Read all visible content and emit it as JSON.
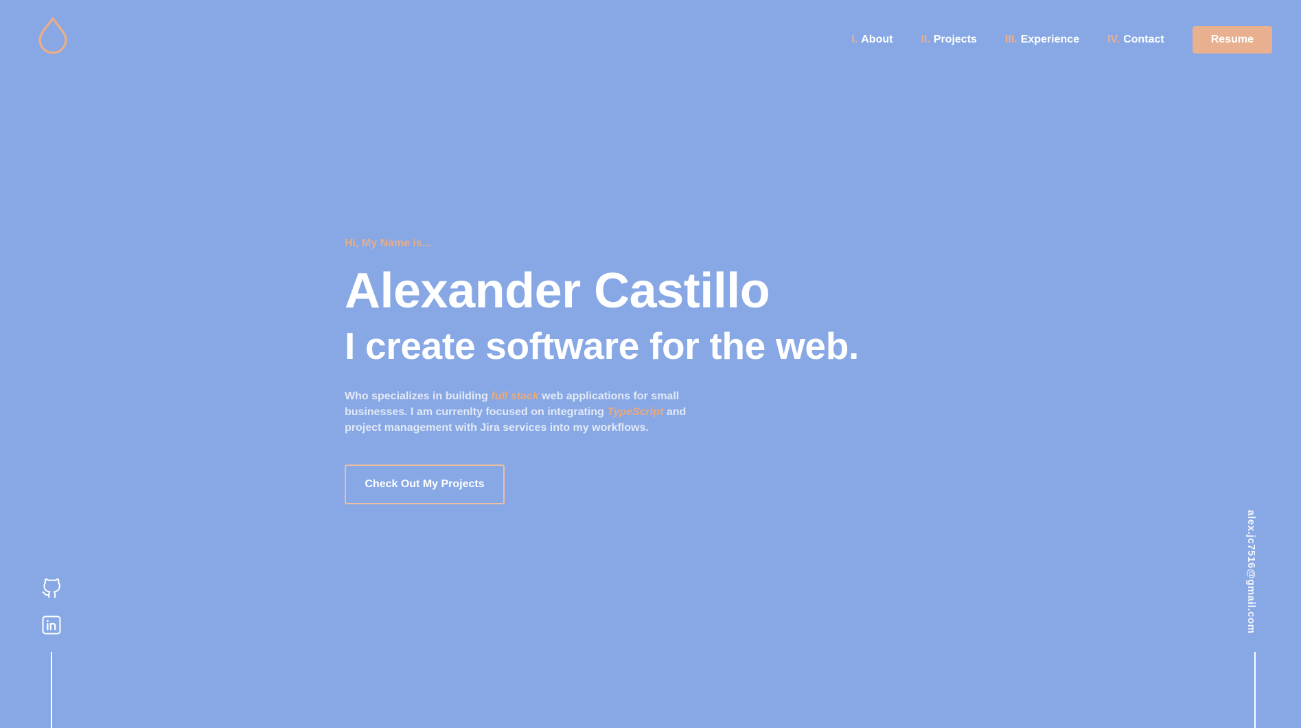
{
  "colors": {
    "background": "#87a8e5",
    "accent": "#e8b08f",
    "text": "#ffffff"
  },
  "header": {
    "logo_icon": "water-drop-icon",
    "nav": [
      {
        "number": "I.",
        "label": "About"
      },
      {
        "number": "II.",
        "label": "Projects"
      },
      {
        "number": "III.",
        "label": "Experience"
      },
      {
        "number": "IV.",
        "label": "Contact"
      }
    ],
    "resume_label": "Resume"
  },
  "hero": {
    "intro": "Hi, My Name is...",
    "name": "Alexander Castillo",
    "tagline": "I create software for the web.",
    "description": {
      "part1": "Who specializes in building ",
      "highlight1": "full stack",
      "part2": " web applications for small businesses. I am currenlty focused on integrating ",
      "highlight2": "TypeScript",
      "part3": " and project management with Jira services into my workflows."
    },
    "cta_label": "Check Out My Projects"
  },
  "social": {
    "icons": [
      "github-icon",
      "linkedin-icon"
    ]
  },
  "email": "alex.jc7516@gmail.com"
}
